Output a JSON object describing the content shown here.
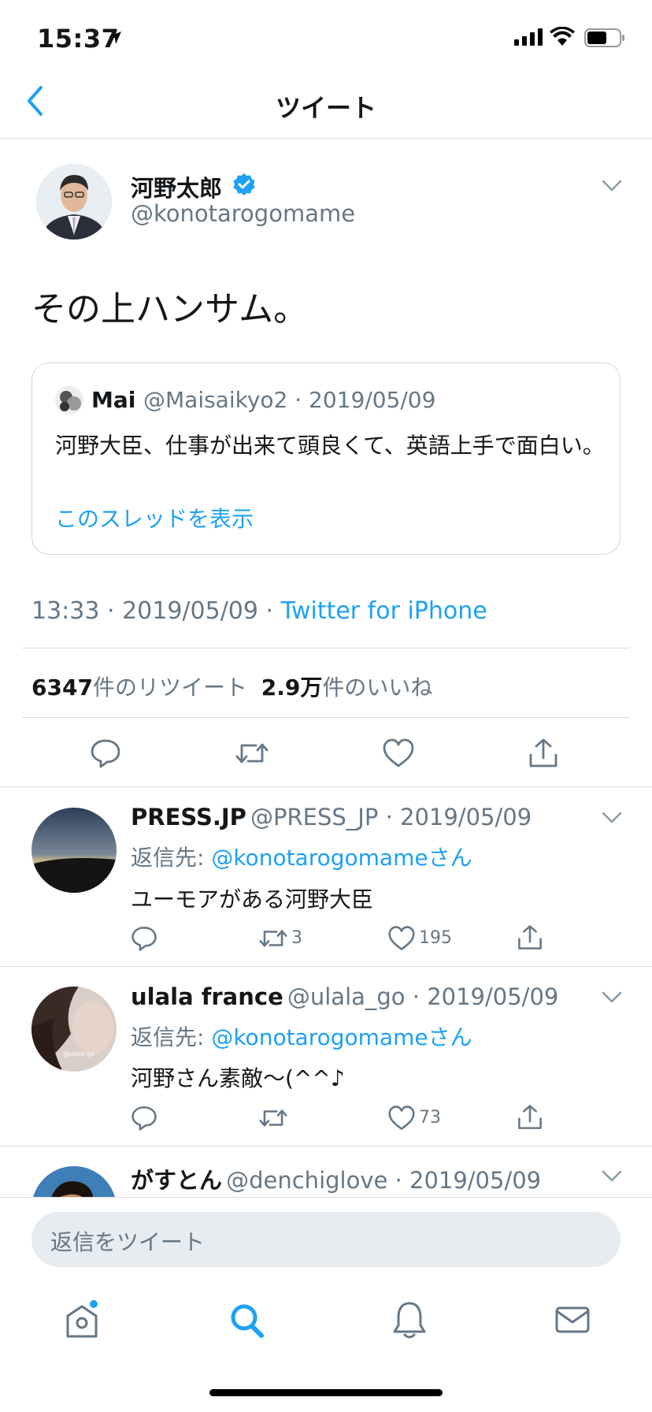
{
  "status_bar": {
    "time": "15:37"
  },
  "nav": {
    "title": "ツイート"
  },
  "main_tweet": {
    "author_name": "河野太郎",
    "author_handle": "@konotarogomame",
    "text": "その上ハンサム。",
    "quote": {
      "name": "Mai",
      "meta": "@Maisaikyo2 · 2019/05/09",
      "text": "河野大臣、仕事が出来て頭良くて、英語上手で面白い。",
      "thread_link": "このスレッドを表示"
    },
    "time": "13:33 · 2019/05/09 · ",
    "source": "Twitter for iPhone",
    "retweet_count": "6347",
    "retweet_label": "件のリツイート",
    "like_count": "2.9万",
    "like_label": "件のいいね"
  },
  "replies": [
    {
      "name": "PRESS.JP",
      "meta": "@PRESS_JP · 2019/05/09",
      "reply_prefix": "返信先: ",
      "reply_to": "@konotarogomameさん",
      "text": "ユーモアがある河野大臣",
      "retweets": "3",
      "likes": "195"
    },
    {
      "name": "ulala france",
      "meta": "@ulala_go · 2019/05/09",
      "reply_prefix": "返信先: ",
      "reply_to": "@konotarogomameさん",
      "text": "河野さん素敵〜(^^♪",
      "retweets": "",
      "likes": "73",
      "avatar_caption": "@ulala go"
    },
    {
      "name": "がすとん",
      "meta": "@denchiglove · 2019/05/09"
    }
  ],
  "compose": {
    "placeholder": "返信をツイート"
  },
  "colors": {
    "accent": "#1da1f2",
    "secondary_text": "#657786",
    "divider": "#d7dbde"
  }
}
